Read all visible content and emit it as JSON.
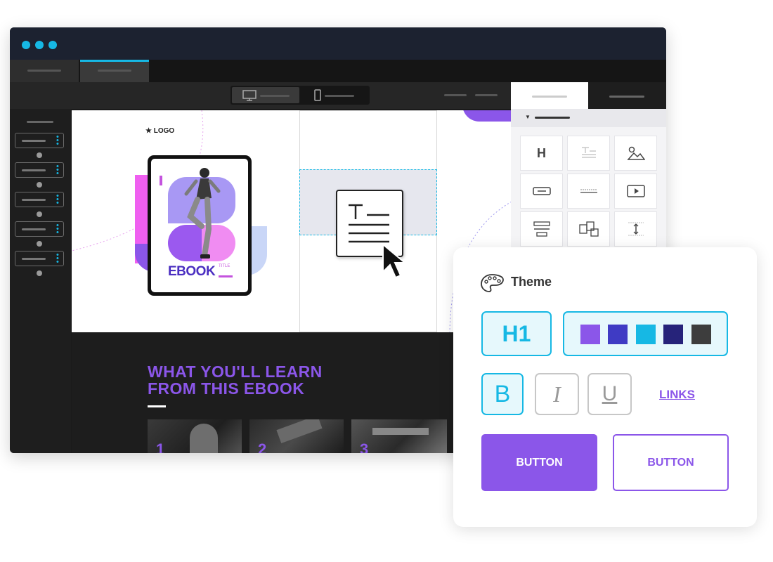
{
  "canvas": {
    "logo_text": "LOGO",
    "ebook_title": "EBOOK",
    "ebook_tag": "TITLE",
    "section_heading_line1": "WHAT YOU'LL LEARN",
    "section_heading_line2": "FROM THIS EBOOK",
    "thumbnails": [
      {
        "number": "1"
      },
      {
        "number": "2"
      },
      {
        "number": "3"
      }
    ]
  },
  "element_panel": {
    "heading_icon_label": "H"
  },
  "theme": {
    "title": "Theme",
    "heading_sample": "H1",
    "palette": [
      "#8b56e9",
      "#3f3bc4",
      "#16b8e4",
      "#26237a",
      "#3d3d3d"
    ],
    "bold_label": "B",
    "italic_label": "I",
    "underline_label": "U",
    "links_label": "LINKS",
    "primary_button_label": "BUTTON",
    "secondary_button_label": "BUTTON"
  },
  "colors": {
    "accent": "#8b56e9",
    "highlight": "#16b8e4",
    "window_dark": "#1a1a1a"
  }
}
